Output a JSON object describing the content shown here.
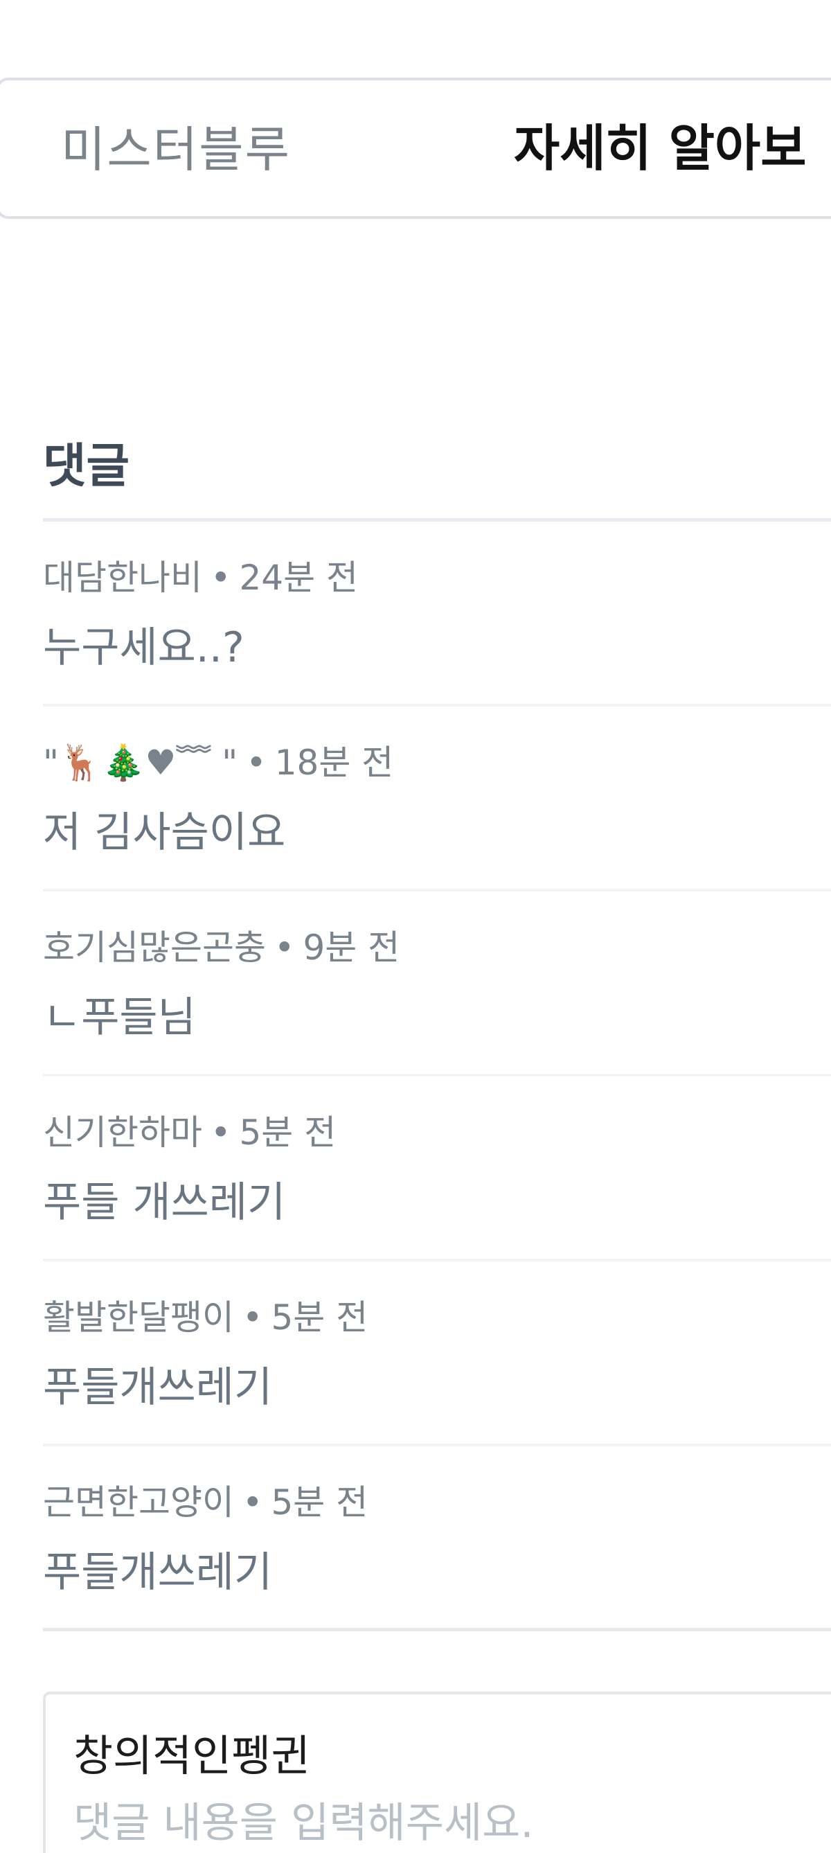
{
  "ad": {
    "brand": "미스터블루",
    "cta": "자세히 알아보"
  },
  "comments_section": {
    "title": "댓글",
    "separator": "•",
    "comments": [
      {
        "author": "대담한나비",
        "time": "24분 전",
        "text": "누구세요..?"
      },
      {
        "author": "\"🦌🎄♥﹌ \"",
        "time": "18분 전",
        "text": "저 김사슴이요"
      },
      {
        "author": "호기심많은곤충",
        "time": "9분 전",
        "text": "ㄴ푸들님"
      },
      {
        "author": "신기한하마",
        "time": "5분 전",
        "text": "푸들 개쓰레기"
      },
      {
        "author": "활발한달팽이",
        "time": "5분 전",
        "text": "푸들개쓰레기"
      },
      {
        "author": "근면한고양이",
        "time": "5분 전",
        "text": "푸들개쓰레기"
      }
    ]
  },
  "composer": {
    "author": "창의적인펭귄",
    "placeholder": "댓글 내용을 입력해주세요."
  }
}
